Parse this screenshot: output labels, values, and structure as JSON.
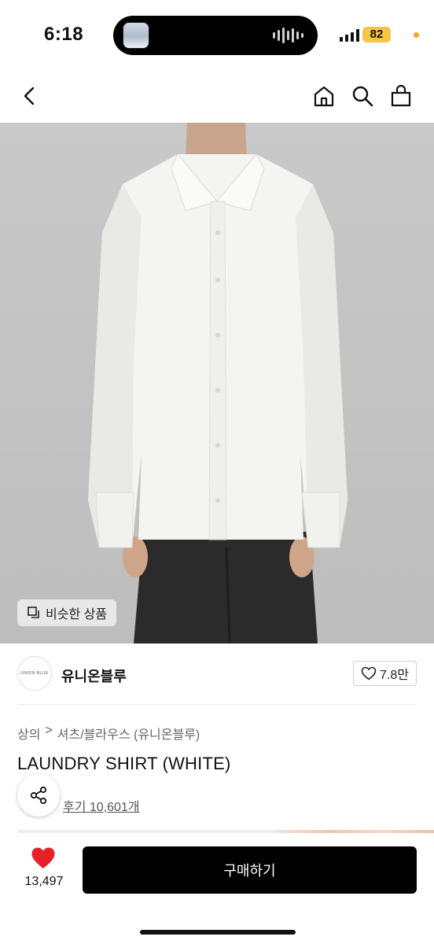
{
  "status_bar": {
    "time": "6:18",
    "battery": "82",
    "colors": {
      "battery": "#f6c543",
      "dot": "#f7a325"
    }
  },
  "nav": {
    "back_icon": "chevron-left-icon",
    "home_icon": "home-icon",
    "search_icon": "search-icon",
    "cart_icon": "shopping-bag-icon"
  },
  "product_image": {
    "similar_label": "비슷한 상품"
  },
  "brand": {
    "logo_text": "UNION BLUE",
    "name": "유니온블루",
    "likes": "7.8만"
  },
  "product": {
    "breadcrumb": [
      "상의",
      ">",
      "셔츠/블라우스 (유니온블루)"
    ],
    "title": "LAUNDRY SHIRT (WHITE)",
    "reviews": "후기 10,601개"
  },
  "bottom_bar": {
    "favorite_count": "13,497",
    "buy_label": "구매하기",
    "colors": {
      "heart": "#e8202a",
      "buy_bg": "#000000"
    }
  }
}
